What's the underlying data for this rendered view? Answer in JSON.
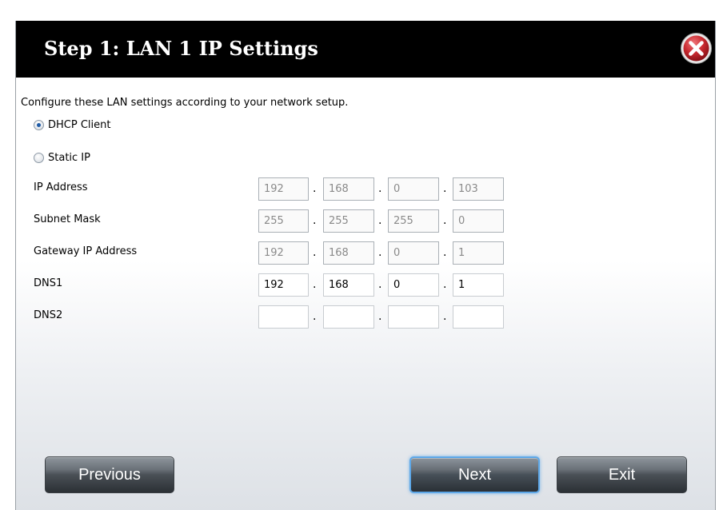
{
  "dialog": {
    "title": "Step 1: LAN 1 IP Settings",
    "close_icon": "close-icon"
  },
  "form": {
    "intro": "Configure these LAN settings according to your network setup.",
    "mode_options": [
      {
        "label": "DHCP Client",
        "checked": true
      },
      {
        "label": "Static IP",
        "checked": false
      }
    ],
    "fields": [
      {
        "label": "IP Address",
        "octets": [
          "192",
          "168",
          "0",
          "103"
        ],
        "disabled": true
      },
      {
        "label": "Subnet Mask",
        "octets": [
          "255",
          "255",
          "255",
          "0"
        ],
        "disabled": true
      },
      {
        "label": "Gateway IP Address",
        "octets": [
          "192",
          "168",
          "0",
          "1"
        ],
        "disabled": true
      },
      {
        "label": "DNS1",
        "octets": [
          "192",
          "168",
          "0",
          "1"
        ],
        "disabled": false
      },
      {
        "label": "DNS2",
        "octets": [
          "",
          "",
          "",
          ""
        ],
        "disabled": false
      }
    ],
    "separator": "."
  },
  "buttons": {
    "previous": "Previous",
    "next": "Next",
    "exit": "Exit"
  },
  "colors": {
    "title_bar": "#000000",
    "title_text": "#ffffff",
    "close_button": "#c0282d",
    "primary_highlight": "#5ea8e8"
  }
}
